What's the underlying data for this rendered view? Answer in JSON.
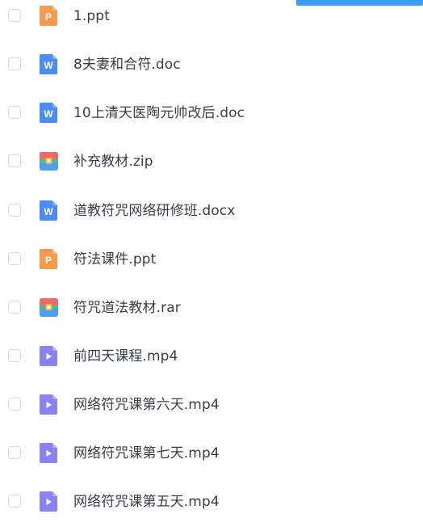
{
  "colors": {
    "ppt": "#f79a4d",
    "doc": "#4a8df7",
    "zip_top": "#f06a6a",
    "zip_bottom": "#4f9cf5",
    "zip_stripe": "#3fc28a",
    "video": "#8b83f4",
    "accent_bar": "#3b9bf5"
  },
  "files": [
    {
      "name": "1.ppt",
      "type": "ppt",
      "icon": "ppt-file-icon",
      "glyph": "P"
    },
    {
      "name": "8夫妻和合符.doc",
      "type": "doc",
      "icon": "word-doc-icon",
      "glyph": "W"
    },
    {
      "name": "10上清天医陶元帅改后.doc",
      "type": "doc",
      "icon": "word-doc-icon",
      "glyph": "W"
    },
    {
      "name": "补充教材.zip",
      "type": "zip",
      "icon": "archive-zip-icon",
      "glyph": ""
    },
    {
      "name": "道教符咒网络研修班.docx",
      "type": "doc",
      "icon": "word-doc-icon",
      "glyph": "W"
    },
    {
      "name": "符法课件.ppt",
      "type": "ppt",
      "icon": "ppt-file-icon",
      "glyph": "P"
    },
    {
      "name": "符咒道法教材.rar",
      "type": "zip",
      "icon": "archive-rar-icon",
      "glyph": ""
    },
    {
      "name": "前四天课程.mp4",
      "type": "video",
      "icon": "video-play-icon",
      "glyph": ""
    },
    {
      "name": "网络符咒课第六天.mp4",
      "type": "video",
      "icon": "video-play-icon",
      "glyph": ""
    },
    {
      "name": "网络符咒课第七天.mp4",
      "type": "video",
      "icon": "video-play-icon",
      "glyph": ""
    },
    {
      "name": "网络符咒课第五天.mp4",
      "type": "video",
      "icon": "video-play-icon",
      "glyph": ""
    }
  ]
}
